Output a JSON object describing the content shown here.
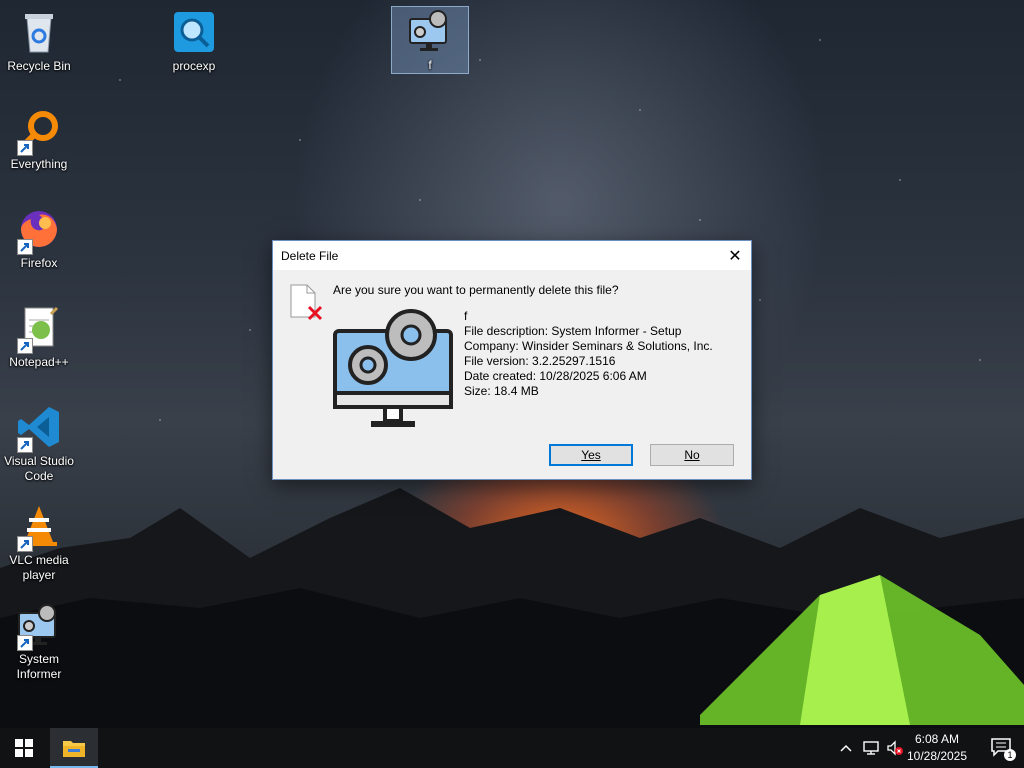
{
  "desktop": {
    "icons": [
      {
        "label": "Recycle Bin",
        "icon": "recycle-bin-icon"
      },
      {
        "label": "procexp",
        "icon": "process-explorer-icon"
      },
      {
        "label": "f",
        "icon": "system-informer-setup-icon"
      },
      {
        "label": "Everything",
        "icon": "everything-search-icon"
      },
      {
        "label": "Firefox",
        "icon": "firefox-icon"
      },
      {
        "label": "Notepad++",
        "icon": "notepad-plus-plus-icon"
      },
      {
        "label": "Visual Studio Code",
        "icon": "vscode-icon"
      },
      {
        "label": "VLC media player",
        "icon": "vlc-icon"
      },
      {
        "label": "System Informer",
        "icon": "system-informer-icon"
      }
    ]
  },
  "dialog": {
    "title": "Delete File",
    "close_label": "✕",
    "question": "Are you sure you want to permanently delete this file?",
    "file_name": "f",
    "description": "File description: System Informer - Setup",
    "company": "Company: Winsider Seminars & Solutions, Inc.",
    "version": "File version: 3.2.25297.1516",
    "created": "Date created: 10/28/2025 6:06 AM",
    "size": "Size: 18.4 MB",
    "yes_label": "Yes",
    "no_label": "No"
  },
  "taskbar": {
    "time": "6:08 AM",
    "date": "10/28/2025",
    "notification_count": "1"
  },
  "colors": {
    "accent": "#0078d7",
    "tent": "#7ed321"
  }
}
